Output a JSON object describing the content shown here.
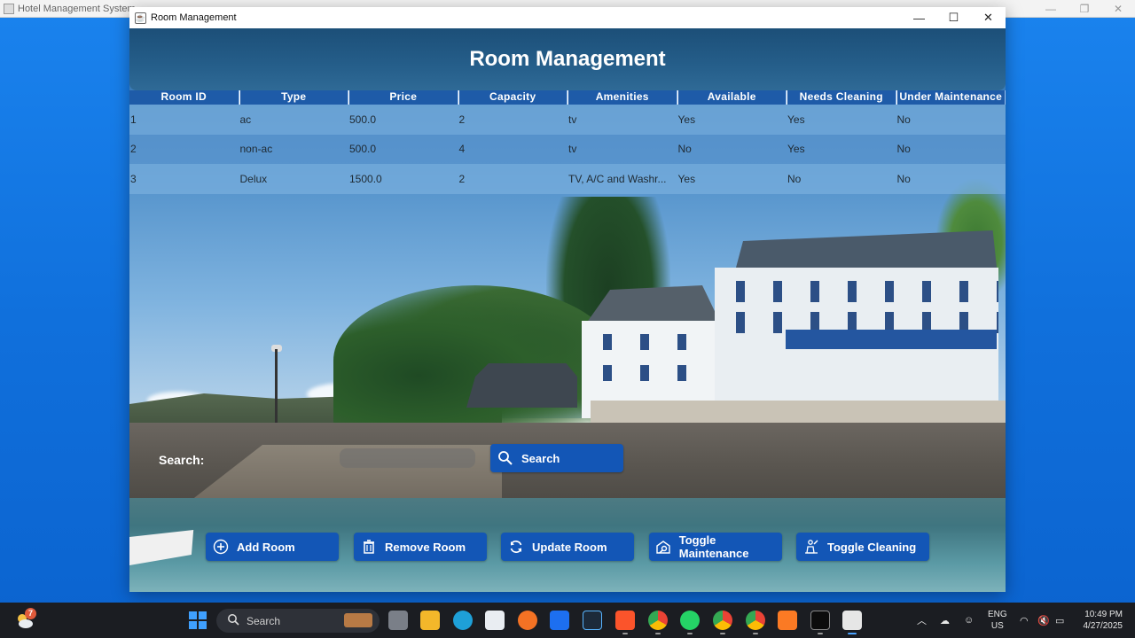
{
  "parent_window": {
    "title": "Hotel Management System"
  },
  "window": {
    "title": "Room Management",
    "controls": {
      "minimize": "—",
      "maximize": "☐",
      "close": "✕"
    }
  },
  "header": {
    "title": "Room Management"
  },
  "table": {
    "columns": [
      "Room ID",
      "Type",
      "Price",
      "Capacity",
      "Amenities",
      "Available",
      "Needs Cleaning",
      "Under Maintenance"
    ],
    "rows": [
      [
        "1",
        "ac",
        "500.0",
        "2",
        "tv",
        "Yes",
        "Yes",
        "No"
      ],
      [
        "2",
        "non-ac",
        "500.0",
        "4",
        "tv",
        "No",
        "Yes",
        "No"
      ],
      [
        "3",
        "Delux",
        "1500.0",
        "2",
        "TV, A/C  and Washr...",
        "Yes",
        "No",
        "No"
      ]
    ]
  },
  "search": {
    "label": "Search:",
    "value": "",
    "button_label": "Search"
  },
  "actions": {
    "add_room": "Add Room",
    "remove_room": "Remove Room",
    "update_room": "Update Room",
    "toggle_maintenance": "Toggle Maintenance",
    "toggle_cleaning": "Toggle Cleaning"
  },
  "colors": {
    "desktop": "#1070dc",
    "header": "#255e8a",
    "table_header": "#1e5ba8",
    "button": "#1356b6"
  },
  "taskbar": {
    "weather_badge": "7",
    "search_placeholder": "Search",
    "apps": [
      "task-view-icon",
      "file-explorer-icon",
      "edge-icon",
      "store-icon",
      "firefox-icon",
      "dropbox-icon",
      "app-icon",
      "brave-icon",
      "chrome-icon",
      "whatsapp-icon",
      "chrome-icon",
      "chrome-icon",
      "xampp-icon",
      "terminal-icon",
      "java-icon"
    ],
    "language": "ENG",
    "region": "US",
    "time": "10:49 PM",
    "date": "4/27/2025"
  }
}
